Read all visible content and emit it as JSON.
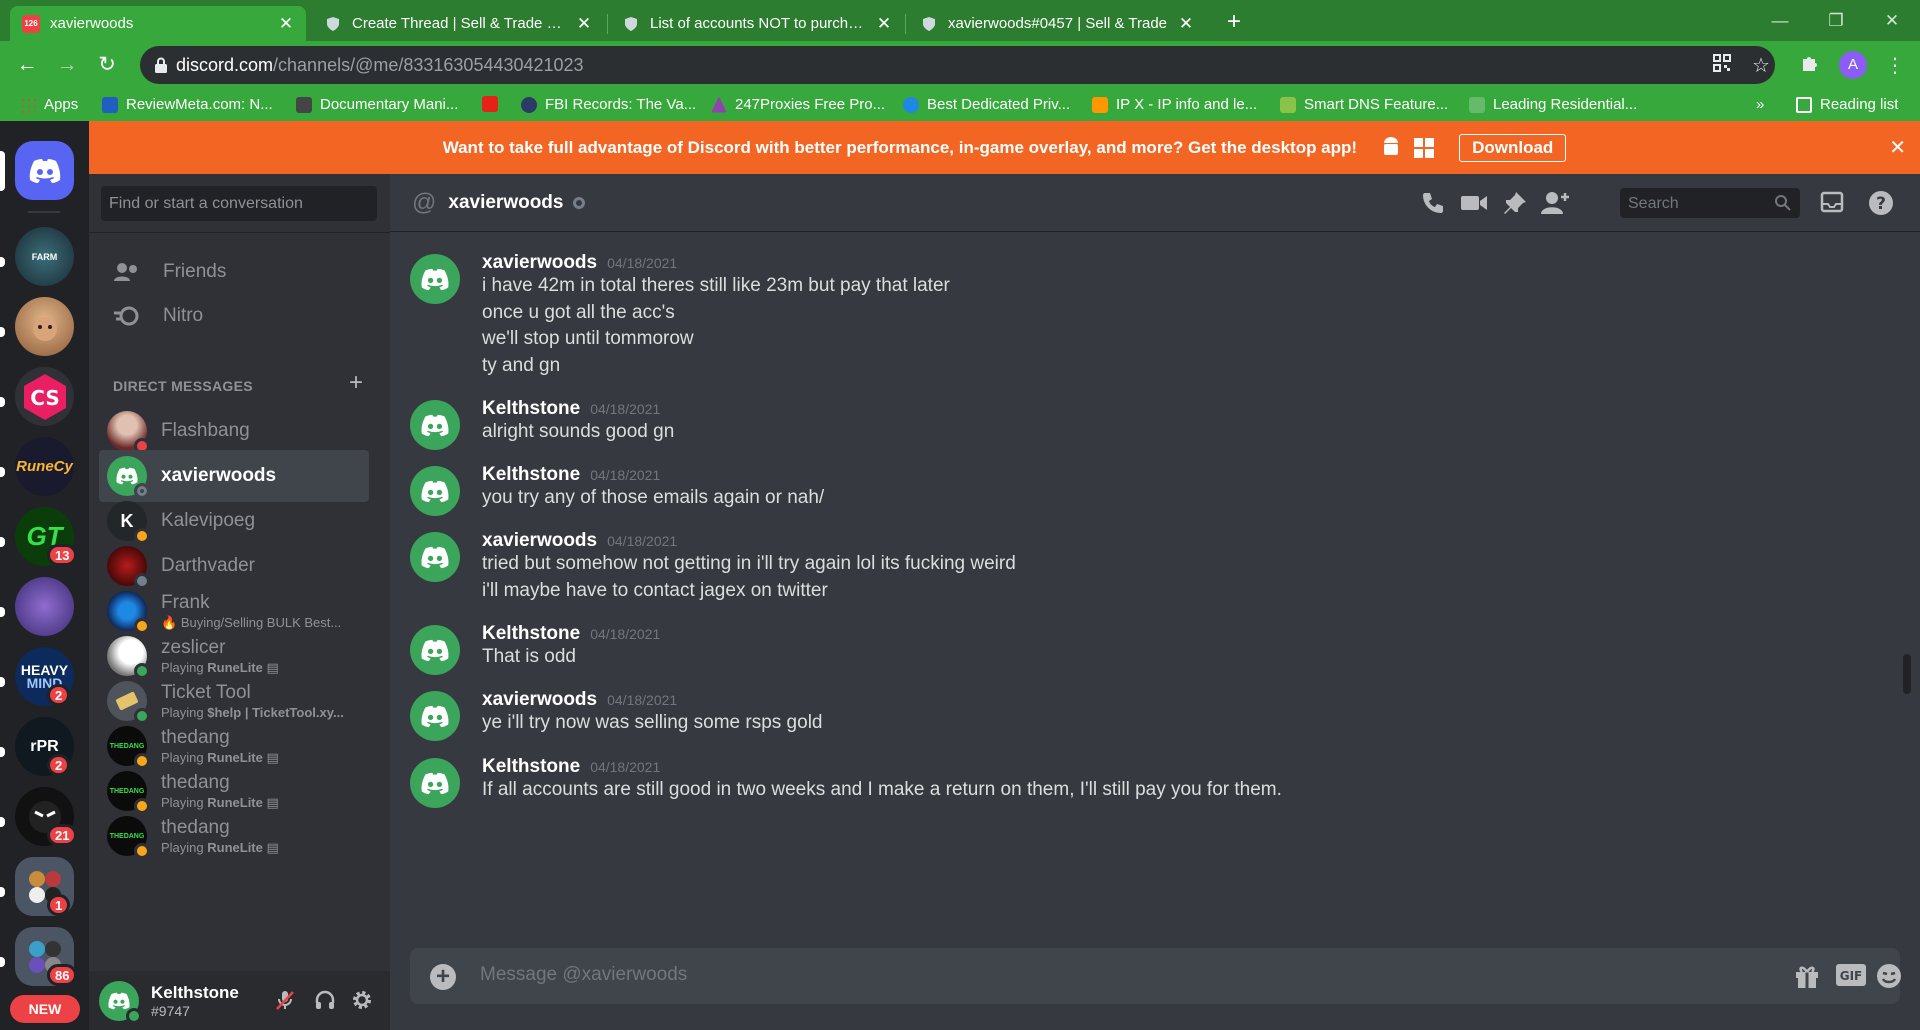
{
  "browser": {
    "tabs": [
      {
        "title": "xavierwoods",
        "active": true
      },
      {
        "title": "Create Thread | Sell & Trade Gam"
      },
      {
        "title": "List of accounts NOT to purchase"
      },
      {
        "title": "xavierwoods#0457 | Sell & Trade"
      }
    ],
    "tab_badge": "126",
    "url_domain": "discord.com",
    "url_path": "/channels/@me/833163054430421023",
    "profile_initial": "A",
    "bookmarks": [
      "Apps",
      "ReviewMeta.com: N...",
      "Documentary Mani...",
      "FBI Records: The Va...",
      "247Proxies Free Pro...",
      "Best Dedicated Priv...",
      "IP X - IP info and le...",
      "Smart DNS Feature...",
      "Leading Residential..."
    ],
    "bookmarks_overflow": "»",
    "reading_list": "Reading list"
  },
  "banner": {
    "text": "Want to take full advantage of Discord with better performance, in-game overlay, and more? Get the desktop app!",
    "button": "Download"
  },
  "guilds": {
    "badges": [
      "13",
      "2",
      "2",
      "21",
      "1",
      "86"
    ],
    "new_label": "NEW",
    "runecy": "RuneCy",
    "gt": "GT",
    "heavy": "HEAVY",
    "mind": "MIND",
    "rpr": "rPR"
  },
  "dm_sidebar": {
    "search_placeholder": "Find or start a conversation",
    "friends": "Friends",
    "nitro": "Nitro",
    "header": "DIRECT MESSAGES",
    "items": [
      {
        "name": "Flashbang",
        "sub": ""
      },
      {
        "name": "xavierwoods",
        "sub": ""
      },
      {
        "name": "Kalevipoeg",
        "sub": ""
      },
      {
        "name": "Darthvader",
        "sub": ""
      },
      {
        "name": "Frank",
        "sub": "Buying/Selling BULK Best..."
      },
      {
        "name": "zeslicer",
        "sub_prefix": "Playing ",
        "sub_bold": "RuneLite"
      },
      {
        "name": "Ticket Tool",
        "sub_prefix": "Playing ",
        "sub_bold": "$help | TicketTool.xy..."
      },
      {
        "name": "thedang",
        "sub_prefix": "Playing ",
        "sub_bold": "RuneLite"
      },
      {
        "name": "thedang",
        "sub_prefix": "Playing ",
        "sub_bold": "RuneLite"
      },
      {
        "name": "thedang",
        "sub_prefix": "Playing ",
        "sub_bold": "RuneLite"
      }
    ]
  },
  "user": {
    "name": "Kelthstone",
    "tag": "#9747"
  },
  "chat": {
    "channel": "xavierwoods",
    "search_placeholder": "Search",
    "composer_placeholder": "Message @xavierwoods",
    "messages": [
      {
        "author": "xavierwoods",
        "ts": "04/18/2021",
        "lines": [
          "i have 42m in total theres still like 23m but pay that later",
          "once u got all the acc's",
          "we'll stop until tommorow",
          "ty and gn"
        ]
      },
      {
        "author": "Kelthstone",
        "ts": "04/18/2021",
        "lines": [
          "alright sounds good gn"
        ]
      },
      {
        "author": "Kelthstone",
        "ts": "04/18/2021",
        "lines": [
          "you try any of those emails again or nah/"
        ]
      },
      {
        "author": "xavierwoods",
        "ts": "04/18/2021",
        "lines": [
          "tried but somehow not getting in i'll try again lol its fucking weird",
          "i'll maybe have to contact jagex on twitter"
        ]
      },
      {
        "author": "Kelthstone",
        "ts": "04/18/2021",
        "lines": [
          "That is odd"
        ]
      },
      {
        "author": "xavierwoods",
        "ts": "04/18/2021",
        "lines": [
          "ye i'll try now was selling some rsps gold"
        ]
      },
      {
        "author": "Kelthstone",
        "ts": "04/18/2021",
        "lines": [
          "If all accounts are still good in two weeks and I make a return on them, I'll still pay you for them."
        ]
      }
    ]
  }
}
